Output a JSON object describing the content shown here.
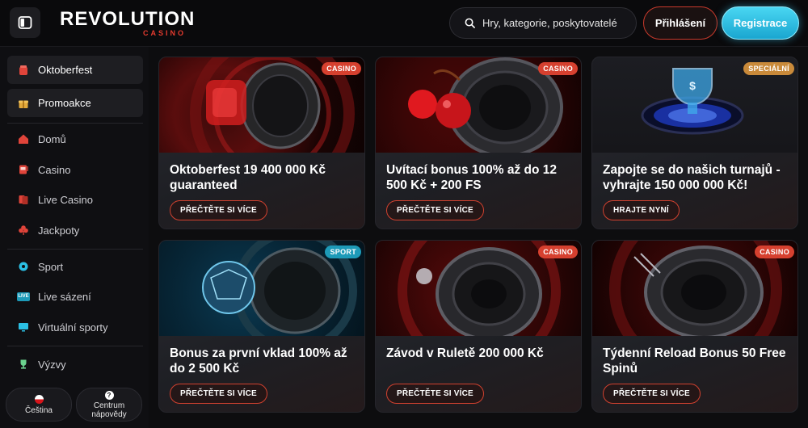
{
  "header": {
    "logo_main": "REVOLUTION",
    "logo_sub": "CASINO",
    "search_placeholder": "Hry, kategorie, poskytovatelé",
    "login_label": "Přihlášení",
    "register_label": "Registrace"
  },
  "sidebar": {
    "promo_items": [
      {
        "label": "Oktoberfest",
        "icon": "barrel-icon"
      },
      {
        "label": "Promoakce",
        "icon": "gift-icon"
      }
    ],
    "casino_items": [
      {
        "label": "Domů",
        "icon": "home-icon"
      },
      {
        "label": "Casino",
        "icon": "slot-machine-icon"
      },
      {
        "label": "Live Casino",
        "icon": "cards-icon"
      },
      {
        "label": "Jackpoty",
        "icon": "clover-icon"
      }
    ],
    "sport_items": [
      {
        "label": "Sport",
        "icon": "ball-icon"
      },
      {
        "label": "Live sázení",
        "icon": "live-icon",
        "icon_text": "LIVE"
      },
      {
        "label": "Virtuální sporty",
        "icon": "monitor-icon"
      }
    ],
    "extra_items": [
      {
        "label": "Výzvy",
        "icon": "trophy-icon"
      }
    ],
    "language_label": "Čeština",
    "help_label_1": "Centrum",
    "help_label_2": "nápovědy"
  },
  "cards": [
    {
      "badge": "CASINO",
      "title": "Oktoberfest 19 400 000 Kč guaranteed",
      "button": "PŘEČTĚTE SI VÍCE"
    },
    {
      "badge": "CASINO",
      "title": "Uvítací bonus 100% až do 12 500 Kč + 200 FS",
      "button": "PŘEČTĚTE SI VÍCE"
    },
    {
      "badge": "SPECIÁLNÍ",
      "title": "Zapojte se do našich turnajů - vyhrajte 150 000 000 Kč!",
      "button": "HRAJTE NYNÍ"
    },
    {
      "badge": "SPORT",
      "title": "Bonus za první vklad 100% až do 2 500 Kč",
      "button": "PŘEČTĚTE SI VÍCE"
    },
    {
      "badge": "CASINO",
      "title": "Závod v Ruletě 200 000 Kč",
      "button": "PŘEČTĚTE SI VÍCE"
    },
    {
      "badge": "CASINO",
      "title": "Týdenní Reload Bonus 50 Free Spinů",
      "button": "PŘEČTĚTE SI VÍCE"
    }
  ],
  "colors": {
    "accent_red": "#d1412f",
    "accent_cyan": "#2bbfe3",
    "badge_casino": "#d6402f",
    "badge_special": "#c98a3a",
    "badge_sport": "#1d9ab8"
  }
}
